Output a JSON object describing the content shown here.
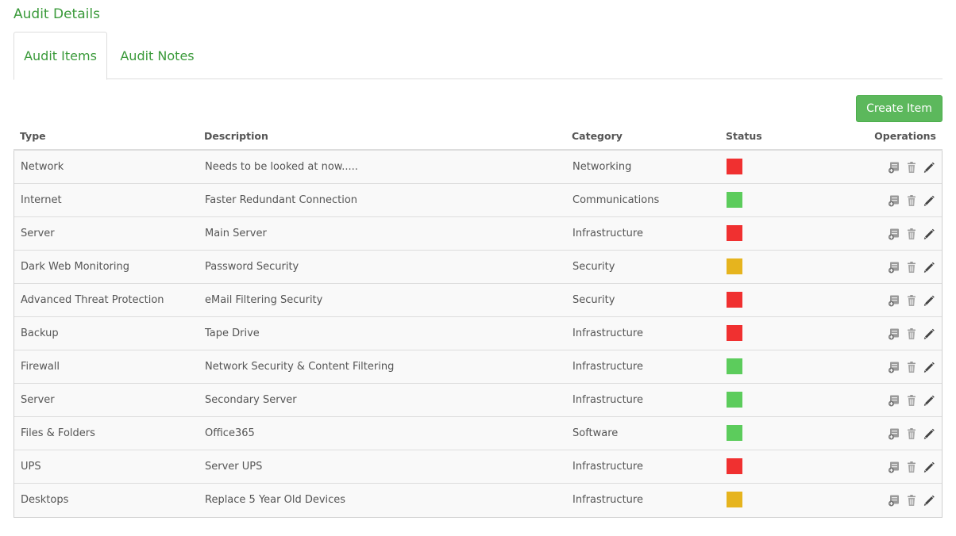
{
  "page": {
    "title": "Audit Details"
  },
  "tabs": [
    {
      "label": "Audit Items",
      "active": true
    },
    {
      "label": "Audit Notes",
      "active": false
    }
  ],
  "toolbar": {
    "create_label": "Create Item"
  },
  "table": {
    "headers": {
      "type": "Type",
      "description": "Description",
      "category": "Category",
      "status": "Status",
      "operations": "Operations"
    },
    "rows": [
      {
        "type": "Network",
        "description": "Needs to be looked at now.....",
        "category": "Networking",
        "status": "red"
      },
      {
        "type": "Internet",
        "description": "Faster Redundant Connection",
        "category": "Communications",
        "status": "green"
      },
      {
        "type": "Server",
        "description": "Main Server",
        "category": "Infrastructure",
        "status": "red"
      },
      {
        "type": "Dark Web Monitoring",
        "description": "Password Security",
        "category": "Security",
        "status": "yellow"
      },
      {
        "type": "Advanced Threat Protection",
        "description": "eMail Filtering Security",
        "category": "Security",
        "status": "red"
      },
      {
        "type": "Backup",
        "description": "Tape Drive",
        "category": "Infrastructure",
        "status": "red"
      },
      {
        "type": "Firewall",
        "description": "Network Security & Content Filtering",
        "category": "Infrastructure",
        "status": "green"
      },
      {
        "type": "Server",
        "description": "Secondary Server",
        "category": "Infrastructure",
        "status": "green"
      },
      {
        "type": "Files & Folders",
        "description": "Office365",
        "category": "Software",
        "status": "green"
      },
      {
        "type": "UPS",
        "description": "Server UPS",
        "category": "Infrastructure",
        "status": "red"
      },
      {
        "type": "Desktops",
        "description": "Replace 5 Year Old Devices",
        "category": "Infrastructure",
        "status": "yellow"
      }
    ]
  },
  "status_colors": {
    "red": "#f03030",
    "green": "#5ccc5c",
    "yellow": "#e6b41e"
  },
  "icons": {
    "op_1": "server-add-icon",
    "op_2": "trash-icon",
    "op_3": "pencil-icon"
  },
  "colors": {
    "accent": "#3a9a3a",
    "button": "#5cb85c"
  }
}
